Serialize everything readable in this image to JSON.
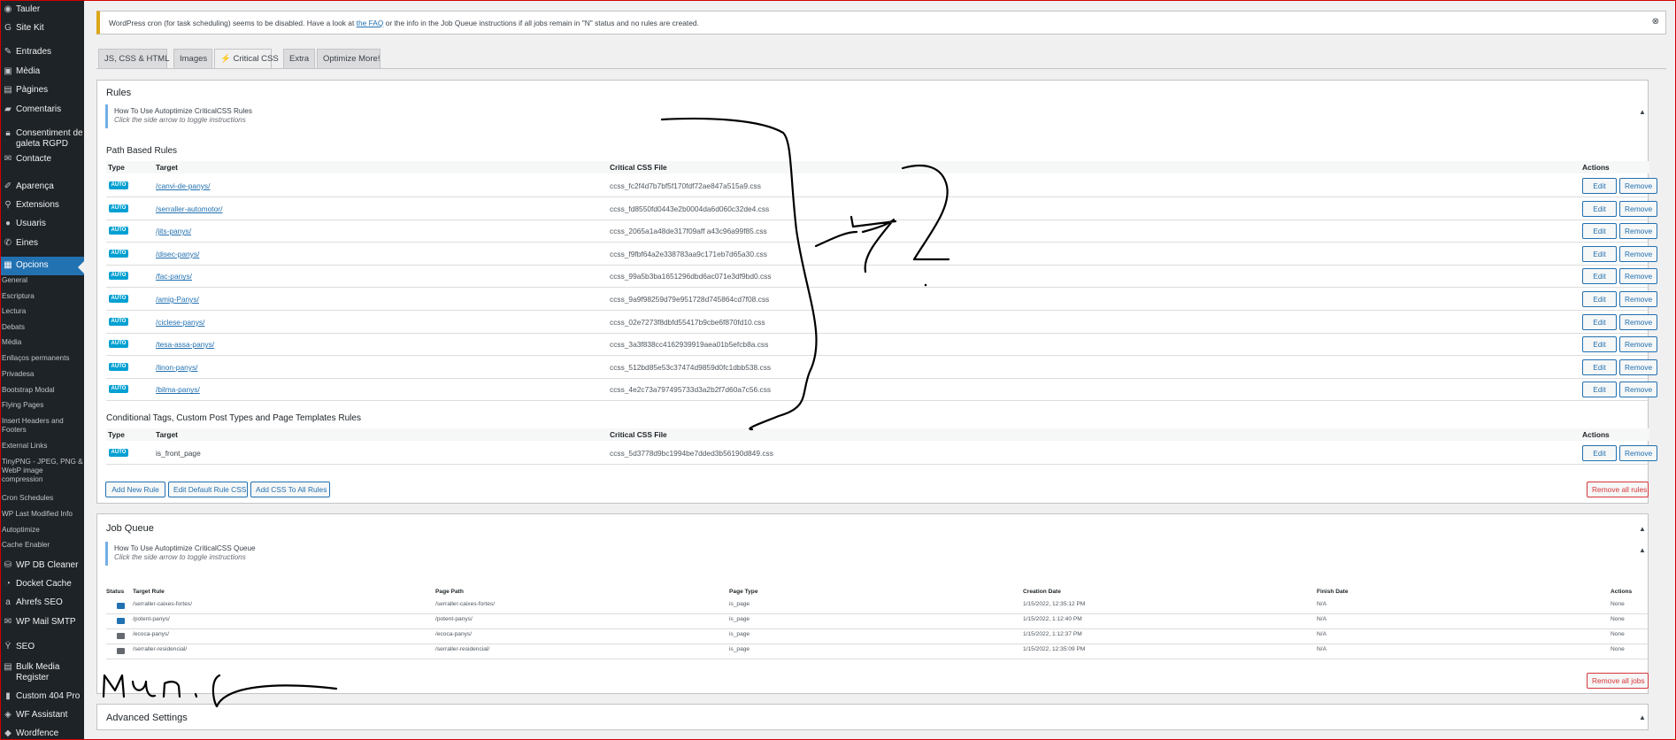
{
  "sidebar": {
    "menu": [
      {
        "icon": "dashboard-icon",
        "glyph": "◉",
        "label": "Tauler"
      },
      {
        "icon": "site-kit-icon",
        "glyph": "G",
        "label": "Site Kit"
      },
      {
        "icon": "pin-icon",
        "glyph": "✎",
        "label": "Entrades"
      },
      {
        "icon": "media-icon",
        "glyph": "▣",
        "label": "Mèdia"
      },
      {
        "icon": "pages-icon",
        "glyph": "▤",
        "label": "Pàgines"
      },
      {
        "icon": "comments-icon",
        "glyph": "▰",
        "label": "Comentaris"
      },
      {
        "icon": "lock-icon",
        "glyph": "🔒︎",
        "label": "Consentiment de galeta RGPD"
      },
      {
        "icon": "mail-icon",
        "glyph": "✉",
        "label": "Contacte"
      },
      {
        "icon": "appearance-icon",
        "glyph": "✐",
        "label": "Aparença"
      },
      {
        "icon": "plugins-icon",
        "glyph": "⚲",
        "label": "Extensions"
      },
      {
        "icon": "users-icon",
        "glyph": "●",
        "label": "Usuaris"
      },
      {
        "icon": "tools-icon",
        "glyph": "✆",
        "label": "Eines"
      },
      {
        "icon": "settings-icon",
        "glyph": "▦",
        "label": "Opcions"
      }
    ],
    "submenu": [
      "General",
      "Escriptura",
      "Lectura",
      "Debats",
      "Mèdia",
      "Enllaços permanents",
      "Privadesa",
      "Bootstrap Modal",
      "Flying Pages",
      "Insert Headers and Footers",
      "External Links",
      "TinyPNG - JPEG, PNG & WebP image compression",
      "Cron Schedules",
      "WP Last Modified Info",
      "Autoptimize",
      "Cache Enabler"
    ],
    "menu2": [
      {
        "icon": "database-icon",
        "glyph": "⛁",
        "label": "WP DB Cleaner"
      },
      {
        "icon": "docket-icon",
        "glyph": "◔",
        "label": "Docket Cache"
      },
      {
        "icon": "ahrefs-icon",
        "glyph": "a",
        "label": "Ahrefs SEO"
      },
      {
        "icon": "smtp-icon",
        "glyph": "✉",
        "label": "WP Mail SMTP"
      },
      {
        "icon": "seo-icon",
        "glyph": "Ÿ",
        "label": "SEO"
      },
      {
        "icon": "bulk-media-icon",
        "glyph": "▤",
        "label": "Bulk Media Register"
      },
      {
        "icon": "chart-icon",
        "glyph": "▮",
        "label": "Custom 404 Pro"
      },
      {
        "icon": "assistant-icon",
        "glyph": "◈",
        "label": "WF Assistant"
      },
      {
        "icon": "wordfence-icon",
        "glyph": "◆",
        "label": "Wordfence"
      }
    ]
  },
  "notice": {
    "text_before": "WordPress cron (for task scheduling) seems to be disabled. Have a look at ",
    "link": "the FAQ",
    "text_after": " or the info in the Job Queue instructions if all jobs remain in \"N\" status and no rules are created.",
    "close": "⊗"
  },
  "tabs": [
    "JS, CSS & HTML",
    "Images",
    "⚡ Critical CSS",
    "Extra",
    "Optimize More!"
  ],
  "rules": {
    "title": "Rules",
    "howto_title": "How To Use Autoptimize CriticalCSS Rules",
    "howto_hint": "Click the side arrow to toggle instructions",
    "path_title": "Path Based Rules",
    "columns": {
      "type": "Type",
      "target": "Target",
      "file": "Critical CSS File",
      "actions": "Actions"
    },
    "badge": "AUTO",
    "edit_label": "Edit",
    "remove_label": "Remove",
    "path_rows": [
      {
        "target": "/canvi-de-panys/",
        "file": "ccss_fc2f4d7b7bf5f170fdf72ae847a515a9.css"
      },
      {
        "target": "/serraller-automotor/",
        "file": "ccss_fd8550fd0443e2b0004da6d060c32de4.css"
      },
      {
        "target": "/jits-panys/",
        "file": "ccss_2065a1a48de317f09aff a43c96a99f85.css"
      },
      {
        "target": "/disec-panys/",
        "file": "ccss_f9fbf64a2e338783aa9c171eb7d65a30.css"
      },
      {
        "target": "/fac-panys/",
        "file": "ccss_99a5b3ba1651296dbd6ac071e3df9bd0.css"
      },
      {
        "target": "/amig-Panys/",
        "file": "ccss_9a9f98259d79e951728d745864cd7f08.css"
      },
      {
        "target": "/ciclese-panys/",
        "file": "ccss_02e7273f8dbfd55417b9cbe6f870fd10.css"
      },
      {
        "target": "/tesa-assa-panys/",
        "file": "ccss_3a3f838cc4162939919aea01b5efcb8a.css"
      },
      {
        "target": "/linon-panys/",
        "file": "ccss_512bd85e53c37474d9859d0fc1dbb538.css"
      },
      {
        "target": "/bilma-panys/",
        "file": "ccss_4e2c73a797495733d3a2b2f7d60a7c56.css"
      }
    ],
    "cond_title": "Conditional Tags, Custom Post Types and Page Templates Rules",
    "cond_rows": [
      {
        "target": "is_front_page",
        "file": "ccss_5d3778d9bc1994be7dded3b56190d849.css"
      }
    ],
    "add_rule": "Add New Rule",
    "edit_default": "Edit Default Rule CSS",
    "add_all": "Add CSS To All Rules",
    "remove_all": "Remove all rules"
  },
  "jobs": {
    "title": "Job Queue",
    "howto_title": "How To Use Autoptimize CriticalCSS Queue",
    "howto_hint": "Click the side arrow to toggle instructions",
    "columns": {
      "status": "Status",
      "target": "Target Rule",
      "path": "Page Path",
      "ptype": "Page Type",
      "created": "Creation Date",
      "finish": "Finish Date",
      "actions": "Actions"
    },
    "rows": [
      {
        "status": "N",
        "color": "#2271b1",
        "target": "/serraller-caixes-fortes/",
        "path": "/serraller-caixes-fortes/",
        "ptype": "is_page",
        "created": "1/15/2022, 12:35:12 PM",
        "finish": "N/A",
        "actions": "None"
      },
      {
        "status": "N",
        "color": "#2271b1",
        "target": "/potent-panys/",
        "path": "/potent-panys/",
        "ptype": "is_page",
        "created": "1/15/2022, 1:12:40 PM",
        "finish": "N/A",
        "actions": "None"
      },
      {
        "status": "R",
        "color": "#646970",
        "target": "/ecoca-panys/",
        "path": "/ecoca-panys/",
        "ptype": "is_page",
        "created": "1/15/2022, 1:12:37 PM",
        "finish": "N/A",
        "actions": "None"
      },
      {
        "status": "R",
        "color": "#646970",
        "target": "/serraller-residencial/",
        "path": "/serraller-residencial/",
        "ptype": "is_page",
        "created": "1/15/2022, 12:35:09 PM",
        "finish": "N/A",
        "actions": "None"
      }
    ],
    "remove_all": "Remove all jobs"
  },
  "advanced": {
    "title": "Advanced Settings"
  },
  "caret": "▲"
}
